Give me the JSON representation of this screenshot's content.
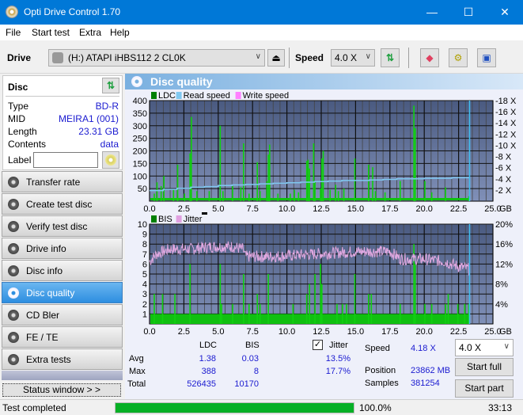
{
  "window": {
    "title": "Opti Drive Control 1.70",
    "minimize": "—",
    "maximize": "☐",
    "close": "✕"
  },
  "menu": [
    "File",
    "Start test",
    "Extra",
    "Help"
  ],
  "toolbar": {
    "drive_label": "Drive",
    "drive_value": "(H:)  ATAPI iHBS112  2 CL0K",
    "speed_label": "Speed",
    "speed_value": "4.0 X"
  },
  "disc": {
    "header": "Disc",
    "rows": [
      {
        "k": "Type",
        "v": "BD-R"
      },
      {
        "k": "MID",
        "v": "MEIRA1 (001)"
      },
      {
        "k": "Length",
        "v": "23.31 GB"
      },
      {
        "k": "Contents",
        "v": "data"
      }
    ],
    "label_key": "Label",
    "label_value": ""
  },
  "nav": [
    {
      "label": "Transfer rate"
    },
    {
      "label": "Create test disc"
    },
    {
      "label": "Verify test disc"
    },
    {
      "label": "Drive info"
    },
    {
      "label": "Disc info"
    },
    {
      "label": "Disc quality",
      "active": true
    },
    {
      "label": "CD Bler"
    },
    {
      "label": "FE / TE"
    },
    {
      "label": "Extra tests"
    }
  ],
  "status_window_btn": "Status window > >",
  "panel_title": "Disc quality",
  "stats": {
    "col_ldc": "LDC",
    "col_bis": "BIS",
    "row_avg": "Avg",
    "row_max": "Max",
    "row_total": "Total",
    "ldc_avg": "1.38",
    "ldc_max": "388",
    "ldc_total": "526435",
    "bis_avg": "0.03",
    "bis_max": "8",
    "bis_total": "10170",
    "jitter_label": "Jitter",
    "jitter_checked": true,
    "jitter_avg": "13.5%",
    "jitter_max": "17.7%",
    "speed_label": "Speed",
    "speed_value": "4.18 X",
    "position_label": "Position",
    "position_value": "23862 MB",
    "samples_label": "Samples",
    "samples_value": "381254",
    "speed_select": "4.0 X",
    "start_full": "Start full",
    "start_part": "Start part"
  },
  "statusbar": {
    "text": "Test completed",
    "progress_pct": 100,
    "progress_text": "100.0%",
    "time": "33:13"
  },
  "chart_data": [
    {
      "type": "bar",
      "title": "LDC / Read speed",
      "legend": [
        {
          "name": "LDC",
          "color": "#008000"
        },
        {
          "name": "Read speed",
          "color": "#80c8f0"
        },
        {
          "name": "Write speed",
          "color": "#ff80ff"
        }
      ],
      "xlabel": "GB",
      "xlim": [
        0,
        25
      ],
      "ylim": [
        0,
        400
      ],
      "y2lim": [
        0,
        18
      ],
      "xticks": [
        "0.0",
        "2.5",
        "5.0",
        "7.5",
        "10.0",
        "12.5",
        "15.0",
        "17.5",
        "20.0",
        "22.5",
        "25.0"
      ],
      "yticks": [
        "50",
        "100",
        "150",
        "200",
        "250",
        "300",
        "350",
        "400"
      ],
      "y2ticks": [
        "2 X",
        "4 X",
        "6 X",
        "8 X",
        "10 X",
        "12 X",
        "14 X",
        "16 X",
        "18 X"
      ],
      "ldc_peaks": [
        [
          0.3,
          30
        ],
        [
          0.5,
          75
        ],
        [
          0.8,
          60
        ],
        [
          1.0,
          100
        ],
        [
          1.7,
          45
        ],
        [
          2.0,
          145
        ],
        [
          2.5,
          30
        ],
        [
          2.9,
          190
        ],
        [
          3.0,
          335
        ],
        [
          3.4,
          40
        ],
        [
          4.3,
          40
        ],
        [
          5.1,
          300
        ],
        [
          5.3,
          40
        ],
        [
          6.0,
          60
        ],
        [
          6.6,
          55
        ],
        [
          6.8,
          230
        ],
        [
          7.2,
          30
        ],
        [
          7.8,
          155
        ],
        [
          8.0,
          40
        ],
        [
          8.5,
          80
        ],
        [
          8.6,
          185
        ],
        [
          8.7,
          225
        ],
        [
          9.3,
          30
        ],
        [
          10.2,
          30
        ],
        [
          10.5,
          45
        ],
        [
          10.8,
          35
        ],
        [
          11.4,
          160
        ],
        [
          11.5,
          165
        ],
        [
          11.6,
          130
        ],
        [
          11.9,
          230
        ],
        [
          12.0,
          80
        ],
        [
          12.4,
          50
        ],
        [
          12.5,
          170
        ],
        [
          12.6,
          200
        ],
        [
          13.1,
          45
        ],
        [
          13.5,
          65
        ],
        [
          13.7,
          40
        ],
        [
          14.1,
          50
        ],
        [
          14.9,
          170
        ],
        [
          15.9,
          145
        ],
        [
          16.2,
          135
        ],
        [
          16.4,
          40
        ],
        [
          17.1,
          35
        ],
        [
          18.2,
          80
        ],
        [
          19.2,
          380
        ],
        [
          19.3,
          290
        ],
        [
          20.0,
          80
        ],
        [
          20.5,
          35
        ],
        [
          21.5,
          55
        ],
        [
          23.2,
          20
        ]
      ],
      "read_speed_steps": [
        [
          0,
          1.9
        ],
        [
          1,
          2.1
        ],
        [
          2,
          2.3
        ],
        [
          3,
          2.5
        ],
        [
          4,
          2.6
        ],
        [
          5,
          2.8
        ],
        [
          6,
          2.9
        ],
        [
          7,
          3.0
        ],
        [
          8,
          3.1
        ],
        [
          9,
          3.2
        ],
        [
          10,
          3.3
        ],
        [
          11,
          3.4
        ],
        [
          12,
          3.5
        ],
        [
          13,
          3.6
        ],
        [
          14,
          3.7
        ],
        [
          15,
          3.7
        ],
        [
          16,
          3.8
        ],
        [
          17,
          3.9
        ],
        [
          18,
          4.0
        ],
        [
          19,
          4.0
        ],
        [
          20,
          4.1
        ],
        [
          21,
          4.1
        ],
        [
          22,
          4.2
        ],
        [
          23,
          4.2
        ],
        [
          23.3,
          4.2
        ]
      ],
      "end_marker": 23.3
    },
    {
      "type": "bar",
      "title": "BIS / Jitter",
      "legend": [
        {
          "name": "BIS",
          "color": "#008000"
        },
        {
          "name": "Jitter",
          "color": "#e0a0e0"
        }
      ],
      "xlabel": "GB",
      "xlim": [
        0,
        25
      ],
      "ylim": [
        0,
        10
      ],
      "y2lim": [
        0,
        20
      ],
      "xticks": [
        "0.0",
        "2.5",
        "5.0",
        "7.5",
        "10.0",
        "12.5",
        "15.0",
        "17.5",
        "20.0",
        "22.5",
        "25.0"
      ],
      "yticks": [
        "1",
        "2",
        "3",
        "4",
        "5",
        "6",
        "7",
        "8",
        "9",
        "10"
      ],
      "y2ticks": [
        "4%",
        "8%",
        "12%",
        "16%",
        "20%"
      ],
      "bis_base": 1,
      "bis_peaks": [
        [
          0.3,
          3
        ],
        [
          0.9,
          3
        ],
        [
          1.8,
          3
        ],
        [
          2.9,
          6
        ],
        [
          5.1,
          6
        ],
        [
          5.2,
          2
        ],
        [
          6.0,
          2
        ],
        [
          6.8,
          5
        ],
        [
          7.2,
          2
        ],
        [
          7.8,
          3
        ],
        [
          8.0,
          2
        ],
        [
          8.6,
          5
        ],
        [
          10.4,
          2
        ],
        [
          11.4,
          3
        ],
        [
          11.6,
          4
        ],
        [
          12.0,
          5
        ],
        [
          12.4,
          6
        ],
        [
          12.5,
          4
        ],
        [
          13.6,
          2
        ],
        [
          14.0,
          2
        ],
        [
          14.3,
          2
        ],
        [
          14.9,
          5
        ],
        [
          15.9,
          3
        ],
        [
          16.1,
          3
        ],
        [
          18.2,
          2
        ],
        [
          19.2,
          8
        ],
        [
          19.3,
          6
        ],
        [
          20.0,
          2
        ],
        [
          20.5,
          2
        ],
        [
          21.5,
          2
        ],
        [
          21.7,
          3
        ],
        [
          22.4,
          2
        ],
        [
          22.9,
          2
        ],
        [
          23.2,
          2
        ]
      ],
      "jitter_segments": [
        [
          0,
          12.5
        ],
        [
          0.5,
          14
        ],
        [
          1.5,
          15
        ],
        [
          3,
          15
        ],
        [
          4.5,
          15.5
        ],
        [
          6,
          15.5
        ],
        [
          6.8,
          15
        ],
        [
          7,
          13.5
        ],
        [
          9,
          13.5
        ],
        [
          12,
          14
        ],
        [
          15,
          14.5
        ],
        [
          17.5,
          14.5
        ],
        [
          18.3,
          13
        ],
        [
          20,
          13
        ],
        [
          21.5,
          12.5
        ],
        [
          22.5,
          11.5
        ],
        [
          23.3,
          11
        ]
      ],
      "end_marker": 23.3
    }
  ]
}
